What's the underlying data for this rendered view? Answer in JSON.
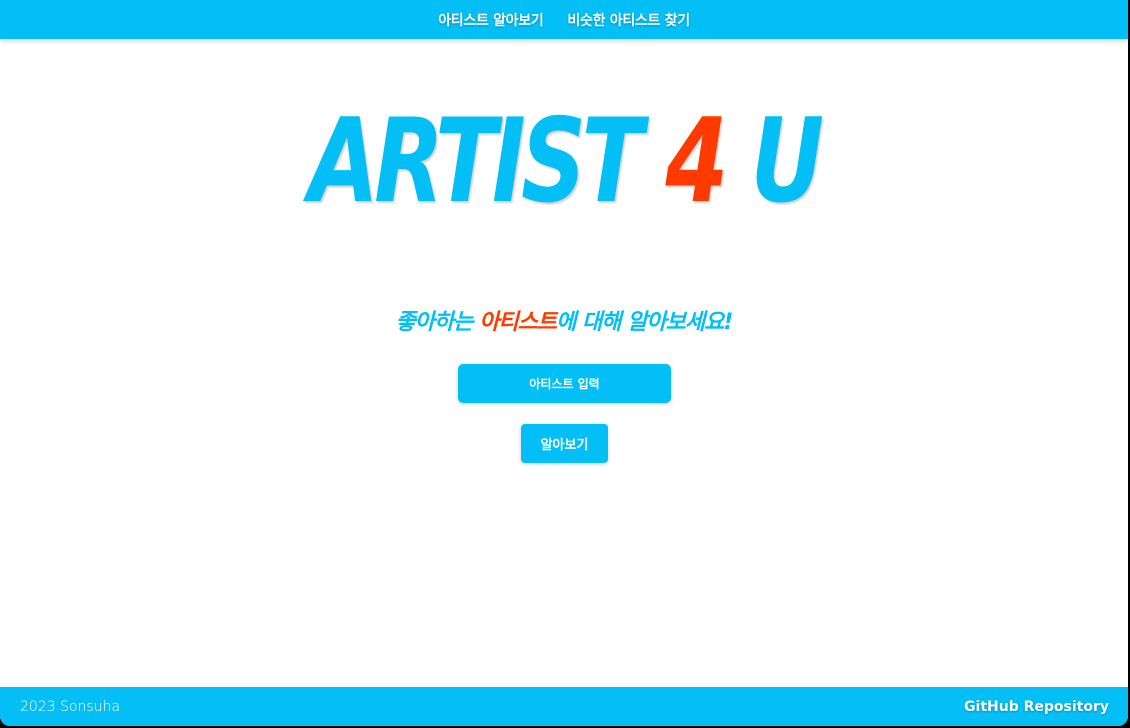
{
  "nav": {
    "items": [
      {
        "label": "아티스트 알아보기"
      },
      {
        "label": "비슷한 아티스트 찾기"
      }
    ]
  },
  "logo": {
    "part1": "ARTIST ",
    "accent": "4",
    "part2": " U"
  },
  "tagline": {
    "before": "좋아하는 ",
    "highlight": "아티스트",
    "after": "에 대해 알아보세요!"
  },
  "form": {
    "input_placeholder": "아티스트 입력",
    "input_value": "",
    "submit_label": "알아보기"
  },
  "footer": {
    "copyright": "2023 Sonsuha",
    "github_label": "GitHub Repository"
  },
  "colors": {
    "primary": "#03bff5",
    "accent": "#ff3a00",
    "background": "#ffffff"
  }
}
